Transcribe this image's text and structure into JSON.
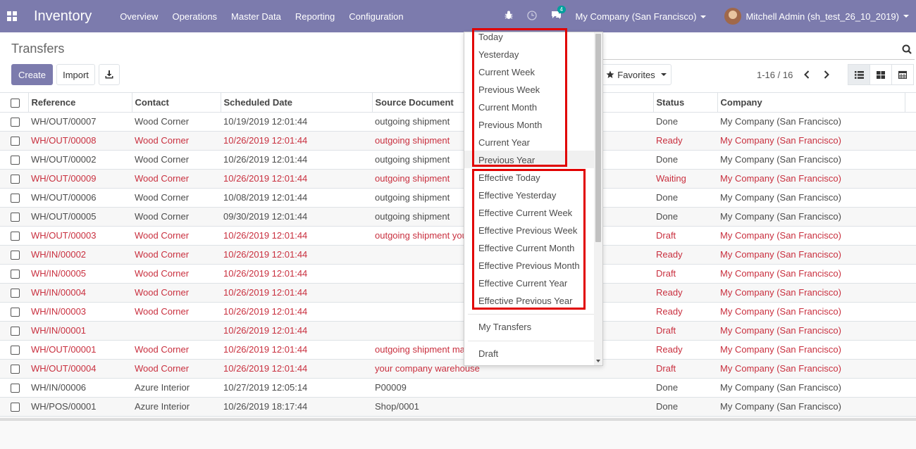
{
  "navbar": {
    "app_title": "Inventory",
    "menu": [
      "Overview",
      "Operations",
      "Master Data",
      "Reporting",
      "Configuration"
    ],
    "message_count": "4",
    "company": "My Company (San Francisco)",
    "user": "Mitchell Admin (sh_test_26_10_2019)"
  },
  "control_panel": {
    "breadcrumb": "Transfers",
    "create_label": "Create",
    "import_label": "Import",
    "favorites_label": "Favorites",
    "pager": "1-16 / 16"
  },
  "table": {
    "headers": [
      "Reference",
      "Contact",
      "Scheduled Date",
      "Source Document",
      "Status",
      "Company"
    ],
    "rows": [
      {
        "ref": "WH/OUT/00007",
        "contact": "Wood Corner",
        "date": "10/19/2019 12:01:44",
        "source": "outgoing shipment",
        "status": "Done",
        "company": "My Company (San Francisco)",
        "late": false
      },
      {
        "ref": "WH/OUT/00008",
        "contact": "Wood Corner",
        "date": "10/26/2019 12:01:44",
        "source": "outgoing shipment",
        "status": "Ready",
        "company": "My Company (San Francisco)",
        "late": true
      },
      {
        "ref": "WH/OUT/00002",
        "contact": "Wood Corner",
        "date": "10/26/2019 12:01:44",
        "source": "outgoing shipment",
        "status": "Done",
        "company": "My Company (San Francisco)",
        "late": false
      },
      {
        "ref": "WH/OUT/00009",
        "contact": "Wood Corner",
        "date": "10/26/2019 12:01:44",
        "source": "outgoing shipment",
        "status": "Waiting",
        "company": "My Company (San Francisco)",
        "late": true
      },
      {
        "ref": "WH/OUT/00006",
        "contact": "Wood Corner",
        "date": "10/08/2019 12:01:44",
        "source": "outgoing shipment",
        "status": "Done",
        "company": "My Company (San Francisco)",
        "late": false
      },
      {
        "ref": "WH/OUT/00005",
        "contact": "Wood Corner",
        "date": "09/30/2019 12:01:44",
        "source": "outgoing shipment",
        "status": "Done",
        "company": "My Company (San Francisco)",
        "late": false
      },
      {
        "ref": "WH/OUT/00003",
        "contact": "Wood Corner",
        "date": "10/26/2019 12:01:44",
        "source": "outgoing shipment you",
        "status": "Draft",
        "company": "My Company (San Francisco)",
        "late": true
      },
      {
        "ref": "WH/IN/00002",
        "contact": "Wood Corner",
        "date": "10/26/2019 12:01:44",
        "source": "",
        "status": "Ready",
        "company": "My Company (San Francisco)",
        "late": true
      },
      {
        "ref": "WH/IN/00005",
        "contact": "Wood Corner",
        "date": "10/26/2019 12:01:44",
        "source": "",
        "status": "Draft",
        "company": "My Company (San Francisco)",
        "late": true
      },
      {
        "ref": "WH/IN/00004",
        "contact": "Wood Corner",
        "date": "10/26/2019 12:01:44",
        "source": "",
        "status": "Ready",
        "company": "My Company (San Francisco)",
        "late": true
      },
      {
        "ref": "WH/IN/00003",
        "contact": "Wood Corner",
        "date": "10/26/2019 12:01:44",
        "source": "",
        "status": "Ready",
        "company": "My Company (San Francisco)",
        "late": true
      },
      {
        "ref": "WH/IN/00001",
        "contact": "",
        "date": "10/26/2019 12:01:44",
        "source": "",
        "status": "Draft",
        "company": "My Company (San Francisco)",
        "late": true
      },
      {
        "ref": "WH/OUT/00001",
        "contact": "Wood Corner",
        "date": "10/26/2019 12:01:44",
        "source": "outgoing shipment ma",
        "status": "Ready",
        "company": "My Company (San Francisco)",
        "late": true
      },
      {
        "ref": "WH/OUT/00004",
        "contact": "Wood Corner",
        "date": "10/26/2019 12:01:44",
        "source": "your company warehouse",
        "status": "Draft",
        "company": "My Company (San Francisco)",
        "late": true
      },
      {
        "ref": "WH/IN/00006",
        "contact": "Azure Interior",
        "date": "10/27/2019 12:05:14",
        "source": "P00009",
        "status": "Done",
        "company": "My Company (San Francisco)",
        "late": false
      },
      {
        "ref": "WH/POS/00001",
        "contact": "Azure Interior",
        "date": "10/26/2019 18:17:44",
        "source": "Shop/0001",
        "status": "Done",
        "company": "My Company (San Francisco)",
        "late": false
      }
    ]
  },
  "dropdown": {
    "group1": [
      "Today",
      "Yesterday",
      "Current Week",
      "Previous Week",
      "Current Month",
      "Previous Month",
      "Current Year",
      "Previous Year"
    ],
    "group2": [
      "Effective Today",
      "Effective Yesterday",
      "Effective Current Week",
      "Effective Previous Week",
      "Effective Current Month",
      "Effective Previous Month",
      "Effective Current Year",
      "Effective Previous Year"
    ],
    "my_transfers": "My Transfers",
    "draft": "Draft"
  },
  "colors": {
    "navbar": "#7c7bad",
    "late_row": "#c9303f",
    "highlight_box": "#e10000"
  }
}
